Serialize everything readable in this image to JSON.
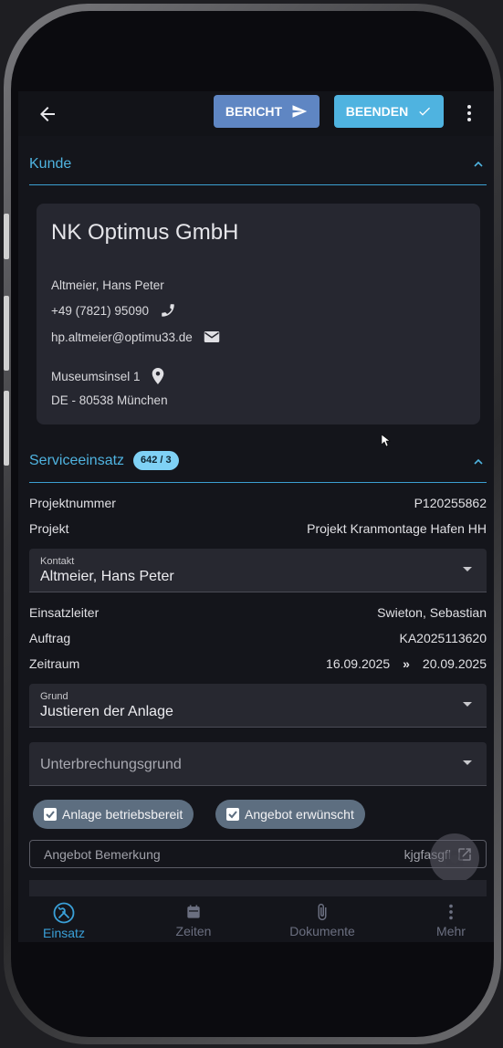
{
  "topbar": {
    "back_icon": "arrow-left-icon",
    "bericht_label": "BERICHT",
    "beenden_label": "BEENDEN",
    "more_icon": "more-vertical-icon"
  },
  "kunde": {
    "section_title": "Kunde",
    "company": "NK Optimus GmbH",
    "contact_name": "Altmeier, Hans Peter",
    "phone": "+49 (7821) 95090",
    "email": "hp.altmeier@optimu33.de",
    "street": "Museumsinsel 1",
    "city": "DE - 80538 München"
  },
  "service": {
    "section_title": "Serviceeinsatz",
    "badge": "642 / 3",
    "projektnummer_label": "Projektnummer",
    "projektnummer_value": "P120255862",
    "projekt_label": "Projekt",
    "projekt_value": "Projekt Kranmontage Hafen HH",
    "kontakt_label": "Kontakt",
    "kontakt_value": "Altmeier, Hans Peter",
    "einsatzleiter_label": "Einsatzleiter",
    "einsatzleiter_value": "Swieton, Sebastian",
    "auftrag_label": "Auftrag",
    "auftrag_value": "KA2025113620",
    "zeitraum_label": "Zeitraum",
    "zeitraum_from": "16.09.2025",
    "zeitraum_sep": "»",
    "zeitraum_to": "20.09.2025",
    "grund_label": "Grund",
    "grund_value": "Justieren der Anlage",
    "unterbrechung_placeholder": "Unterbrechungsgrund",
    "chip_anlage": "Anlage betriebsbereit",
    "chip_angebot": "Angebot erwünscht",
    "bemerkung_placeholder": "Angebot Bemerkung",
    "bemerkung_value": "kjgfasgfl"
  },
  "bottom_nav": {
    "items": [
      {
        "label": "Einsatz",
        "icon": "tools-icon",
        "active": true
      },
      {
        "label": "Zeiten",
        "icon": "calendar-icon",
        "active": false
      },
      {
        "label": "Dokumente",
        "icon": "paperclip-icon",
        "active": false
      },
      {
        "label": "Mehr",
        "icon": "more-vertical-icon",
        "active": false
      }
    ]
  },
  "colors": {
    "accent": "#4fb3e0",
    "bericht_button": "#5f86c3",
    "chip": "#5d6e80",
    "background": "#14151b"
  }
}
